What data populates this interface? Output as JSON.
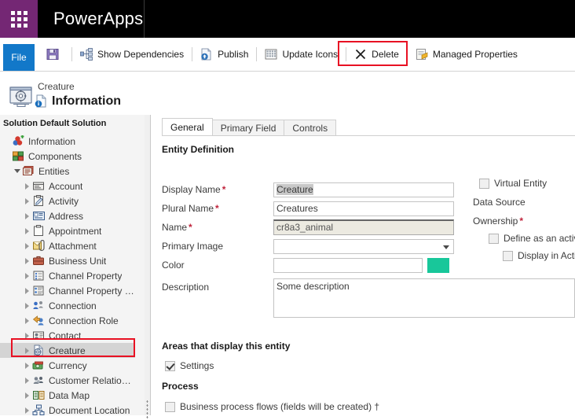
{
  "topbar": {
    "waffle_icon": "app-launcher-icon",
    "brand": "PowerApps"
  },
  "ribbon": {
    "file_label": "File",
    "commands": [
      {
        "icon": "save-icon",
        "label": ""
      },
      {
        "icon": "show-dependencies-icon",
        "label": "Show Dependencies"
      },
      {
        "icon": "publish-icon",
        "label": "Publish"
      },
      {
        "icon": "update-icons-icon",
        "label": "Update Icons"
      },
      {
        "icon": "delete-icon",
        "label": "Delete"
      },
      {
        "icon": "managed-properties-icon",
        "label": "Managed Properties"
      }
    ],
    "highlight_color": "#e81123"
  },
  "page_header": {
    "breadcrumb": "Creature",
    "title": "Information",
    "entity_icon": "entity-settings-icon",
    "info_icon": "information-icon"
  },
  "sidebar": {
    "solution_title": "Solution Default Solution",
    "tree": [
      {
        "label": "Information",
        "indent": 0,
        "twist": "none",
        "icon": "information-tree-icon"
      },
      {
        "label": "Components",
        "indent": 0,
        "twist": "none",
        "icon": "components-icon"
      },
      {
        "label": "Entities",
        "indent": 1,
        "twist": "open",
        "icon": "entities-icon"
      },
      {
        "label": "Account",
        "indent": 2,
        "twist": "closed",
        "icon": "account-icon"
      },
      {
        "label": "Activity",
        "indent": 2,
        "twist": "closed",
        "icon": "activity-icon"
      },
      {
        "label": "Address",
        "indent": 2,
        "twist": "closed",
        "icon": "address-icon"
      },
      {
        "label": "Appointment",
        "indent": 2,
        "twist": "closed",
        "icon": "appointment-icon"
      },
      {
        "label": "Attachment",
        "indent": 2,
        "twist": "closed",
        "icon": "attachment-icon"
      },
      {
        "label": "Business Unit",
        "indent": 2,
        "twist": "closed",
        "icon": "business-unit-icon"
      },
      {
        "label": "Channel Property",
        "indent": 2,
        "twist": "closed",
        "icon": "channel-property-icon"
      },
      {
        "label": "Channel Property G...",
        "indent": 2,
        "twist": "closed",
        "icon": "channel-property-group-icon"
      },
      {
        "label": "Connection",
        "indent": 2,
        "twist": "closed",
        "icon": "connection-icon"
      },
      {
        "label": "Connection Role",
        "indent": 2,
        "twist": "closed",
        "icon": "connection-role-icon"
      },
      {
        "label": "Contact",
        "indent": 2,
        "twist": "closed",
        "icon": "contact-icon"
      },
      {
        "label": "Creature",
        "indent": 2,
        "twist": "closed",
        "icon": "creature-icon",
        "selected": true
      },
      {
        "label": "Currency",
        "indent": 2,
        "twist": "closed",
        "icon": "currency-icon"
      },
      {
        "label": "Customer Relations...",
        "indent": 2,
        "twist": "closed",
        "icon": "customer-relationship-icon"
      },
      {
        "label": "Data Map",
        "indent": 2,
        "twist": "closed",
        "icon": "data-map-icon"
      },
      {
        "label": "Document Location",
        "indent": 2,
        "twist": "closed",
        "icon": "document-location-icon"
      }
    ]
  },
  "content": {
    "tabs": [
      {
        "label": "General",
        "active": true
      },
      {
        "label": "Primary Field",
        "active": false
      },
      {
        "label": "Controls",
        "active": false
      }
    ],
    "section_entity_definition": "Entity Definition",
    "fields": {
      "display_name_label": "Display Name",
      "display_name_value": "Creature",
      "plural_name_label": "Plural Name",
      "plural_name_value": "Creatures",
      "name_label": "Name",
      "name_value": "cr8a3_animal",
      "primary_image_label": "Primary Image",
      "primary_image_value": "",
      "color_label": "Color",
      "color_value": "",
      "color_swatch": "#18c79a",
      "description_label": "Description",
      "description_value": "Some description"
    },
    "right_column": {
      "virtual_entity_label": "Virtual Entity",
      "virtual_entity_checked": false,
      "data_source_label": "Data Source",
      "ownership_label": "Ownership",
      "define_activity_label": "Define as an activity",
      "define_activity_checked": false,
      "display_in_activity_label": "Display in Activi",
      "display_in_activity_checked": false
    },
    "areas_section": "Areas that display this entity",
    "areas": [
      {
        "label": "Settings",
        "checked": true
      }
    ],
    "process_section": "Process",
    "process": [
      {
        "label": "Business process flows (fields will be created) †",
        "checked": false
      }
    ]
  }
}
